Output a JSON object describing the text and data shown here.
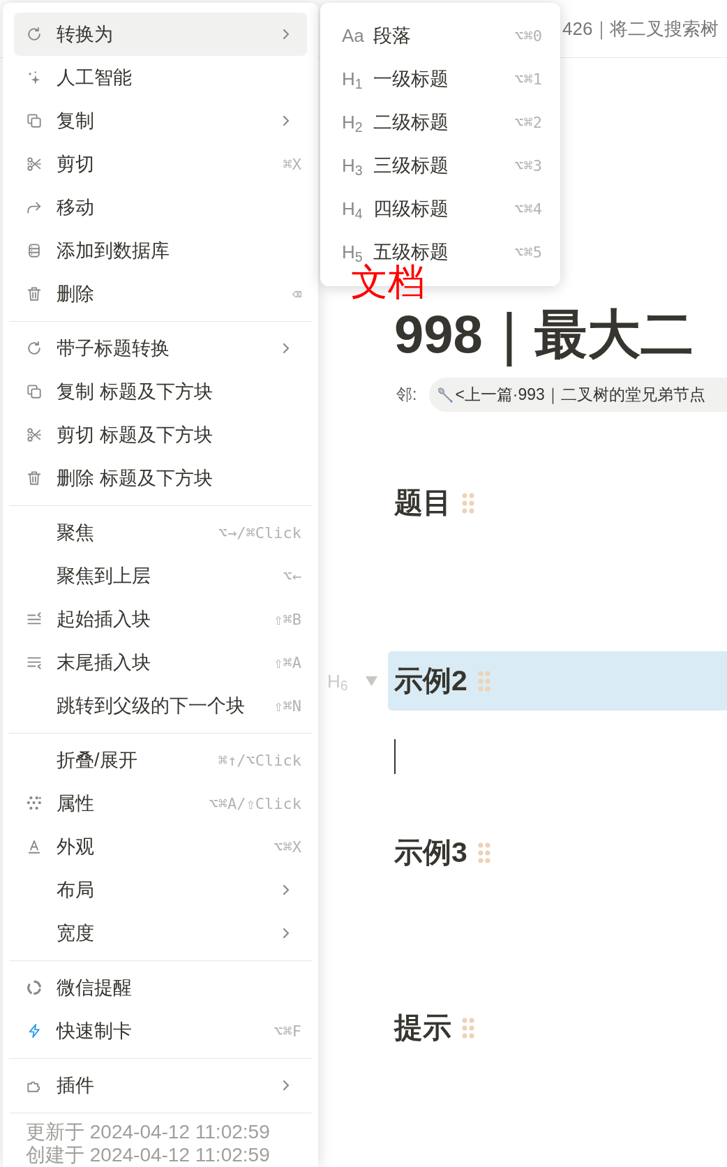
{
  "context_menu": {
    "sections": [
      {
        "items": [
          {
            "label": "转换为",
            "submenu": true,
            "selected": true
          },
          {
            "label": "人工智能",
            "submenu": false,
            "selected": false
          },
          {
            "label": "复制",
            "submenu": true,
            "selected": false
          },
          {
            "label": "剪切",
            "shortcut": "⌘X",
            "submenu": false,
            "selected": false
          },
          {
            "label": "移动",
            "submenu": false,
            "selected": false
          },
          {
            "label": "添加到数据库",
            "submenu": false,
            "selected": false
          },
          {
            "label": "删除",
            "shortcut": "⌫",
            "submenu": false,
            "selected": false
          }
        ]
      },
      {
        "items": [
          {
            "label": "带子标题转换",
            "submenu": true,
            "selected": false
          },
          {
            "label": "复制 标题及下方块",
            "submenu": false,
            "selected": false
          },
          {
            "label": "剪切 标题及下方块",
            "submenu": false,
            "selected": false
          },
          {
            "label": "删除 标题及下方块",
            "submenu": false,
            "selected": false
          }
        ]
      },
      {
        "items": [
          {
            "label": "聚焦",
            "shortcut": "⌥→/⌘Click",
            "submenu": false,
            "selected": false
          },
          {
            "label": "聚焦到上层",
            "shortcut": "⌥←",
            "submenu": false,
            "selected": false
          },
          {
            "label": "起始插入块",
            "shortcut": "⇧⌘B",
            "submenu": false,
            "selected": false
          },
          {
            "label": "末尾插入块",
            "shortcut": "⇧⌘A",
            "submenu": false,
            "selected": false
          },
          {
            "label": "跳转到父级的下一个块",
            "shortcut": "⇧⌘N",
            "submenu": false,
            "selected": false
          }
        ]
      },
      {
        "items": [
          {
            "label": "折叠/展开",
            "shortcut": "⌘↑/⌥Click",
            "submenu": false,
            "selected": false
          },
          {
            "label": "属性",
            "shortcut": "⌥⌘A/⇧Click",
            "submenu": false,
            "selected": false
          },
          {
            "label": "外观",
            "shortcut": "⌥⌘X",
            "submenu": false,
            "selected": false
          },
          {
            "label": "布局",
            "submenu": true,
            "selected": false
          },
          {
            "label": "宽度",
            "submenu": true,
            "selected": false
          }
        ]
      },
      {
        "items": [
          {
            "label": "微信提醒",
            "submenu": false,
            "selected": false
          },
          {
            "label": "快速制卡",
            "shortcut": "⌥⌘F",
            "submenu": false,
            "selected": false
          }
        ]
      },
      {
        "items": [
          {
            "label": "插件",
            "submenu": true,
            "selected": false
          }
        ]
      }
    ],
    "footer": {
      "updated": "更新于 2024-04-12 11:02:59",
      "created": "创建于 2024-04-12 11:02:59"
    }
  },
  "submenu": {
    "items": [
      {
        "marker": "Aa",
        "label": "段落",
        "shortcut": "⌥⌘0"
      },
      {
        "marker": "H$_{1}$",
        "label": "一级标题",
        "shortcut": "⌥⌘1"
      },
      {
        "marker": "H$_{2}$",
        "label": "二级标题",
        "shortcut": "⌥⌘2"
      },
      {
        "marker": "H$_{3}$",
        "label": "三级标题",
        "shortcut": "⌥⌘3"
      },
      {
        "marker": "H$_{4}$",
        "label": "四级标题",
        "shortcut": "⌥⌘4"
      },
      {
        "marker": "H$_{5}$",
        "label": "五级标题",
        "shortcut": "⌥⌘5"
      }
    ]
  },
  "annotation": "文档",
  "document": {
    "breadcrumb": "426｜将二叉搜索树",
    "title": "998｜最大二",
    "neighbor": {
      "label": "邻:",
      "link": "<上一篇·993｜二叉树的堂兄弟节点"
    },
    "blocks": [
      {
        "kind": "heading",
        "text": "题目",
        "selected": false
      },
      {
        "kind": "heading",
        "text": "示例2",
        "selected": true,
        "type_marker": "H$_{6}$"
      },
      {
        "kind": "paragraph",
        "caret": true,
        "selected": false
      },
      {
        "kind": "heading",
        "text": "示例3",
        "selected": false
      },
      {
        "kind": "heading",
        "text": "提示",
        "selected": false
      }
    ]
  }
}
